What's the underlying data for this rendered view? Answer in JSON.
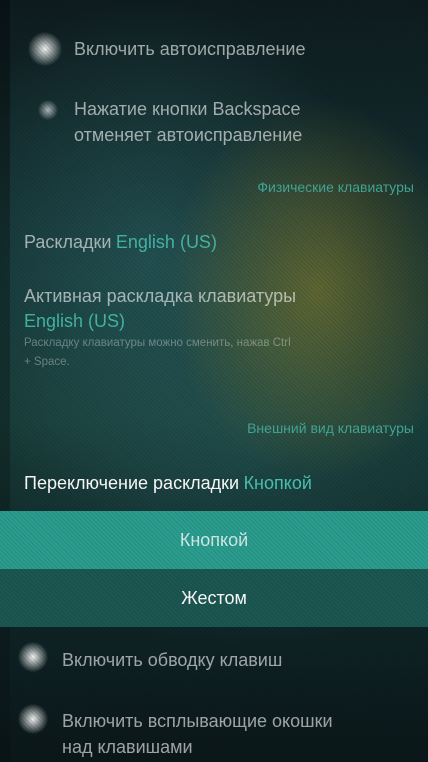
{
  "text_input": {
    "autocorrect": {
      "label": "Включить автоисправление"
    },
    "backspace_undo": {
      "label_line1": "Нажатие кнопки Backspace",
      "label_line2": "отменяет автоисправление"
    }
  },
  "physical_keyboards": {
    "section_title": "Физические клавиатуры",
    "layouts": {
      "label": "Раскладки",
      "value": "English (US)"
    },
    "active_layout": {
      "label": "Активная раскладка клавиатуры",
      "value": "English (US)",
      "hint_line1": "Раскладку клавиатуры можно сменить, нажав Ctrl",
      "hint_line2": "+ Space."
    }
  },
  "appearance": {
    "section_title": "Внешний вид клавиатуры",
    "switch_layout": {
      "label": "Переключение раскладки",
      "value": "Кнопкой",
      "options": [
        "Кнопкой",
        "Жестом"
      ]
    },
    "key_outline": {
      "label": "Включить обводку клавиш"
    },
    "key_popups": {
      "label_line1": "Включить всплывающие окошки",
      "label_line2": "над клавишами"
    }
  },
  "colors": {
    "accent": "#45b6a6",
    "picker_selected": "#2a9d8f",
    "picker_option": "#1c5752"
  }
}
